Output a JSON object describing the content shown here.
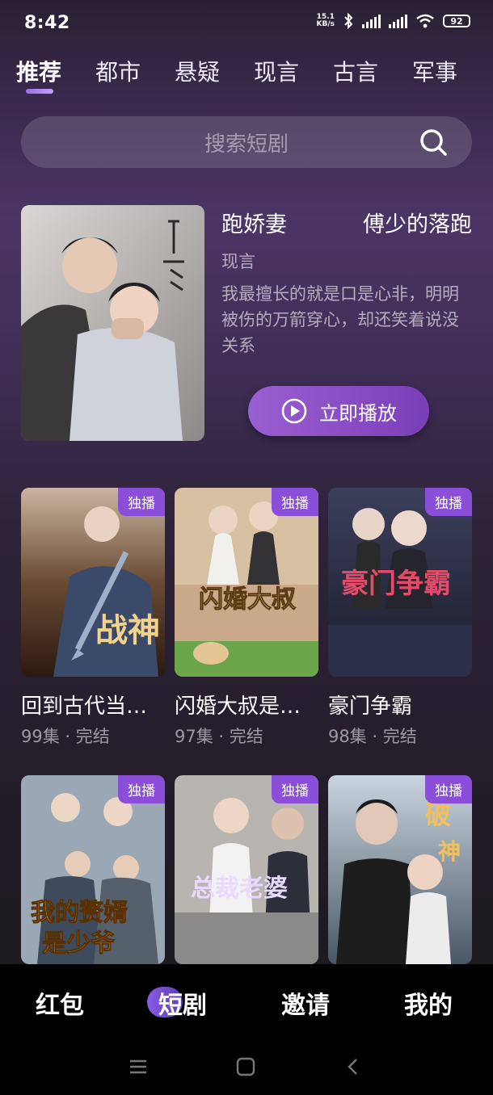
{
  "status": {
    "time": "8:42",
    "speed_value": "15.1",
    "speed_unit": "KB/s",
    "battery": "92",
    "icons": [
      "bluetooth-icon",
      "signal-hd-icon",
      "signal-hd-icon",
      "wifi-icon",
      "battery-icon"
    ]
  },
  "tabs": [
    {
      "label": "推荐",
      "active": true
    },
    {
      "label": "都市"
    },
    {
      "label": "悬疑"
    },
    {
      "label": "现言"
    },
    {
      "label": "古言"
    },
    {
      "label": "军事"
    }
  ],
  "search": {
    "placeholder": "搜索短剧"
  },
  "featured": {
    "title": "跑娇妻",
    "subtitle": "傅少的落跑",
    "genre": "现言",
    "description": "我最擅长的就是口是心非，明明被伤的万箭穿心，却还笑着说没关系",
    "play_label": "立即播放",
    "accent": "#8a4ed8"
  },
  "cards": [
    {
      "title": "回到古代当…",
      "meta": "99集 · 完结",
      "badge": "独播"
    },
    {
      "title": "闪婚大叔是…",
      "meta": "97集 · 完结",
      "badge": "独播"
    },
    {
      "title": "豪门争霸",
      "meta": "98集 · 完结",
      "badge": "独播"
    },
    {
      "title": "",
      "meta": "",
      "badge": "独播"
    },
    {
      "title": "",
      "meta": "",
      "badge": "独播"
    },
    {
      "title": "",
      "meta": "",
      "badge": "独播"
    }
  ],
  "bottom_nav": [
    {
      "label": "红包"
    },
    {
      "label": "短剧",
      "active": true
    },
    {
      "label": "邀请"
    },
    {
      "label": "我的"
    }
  ]
}
